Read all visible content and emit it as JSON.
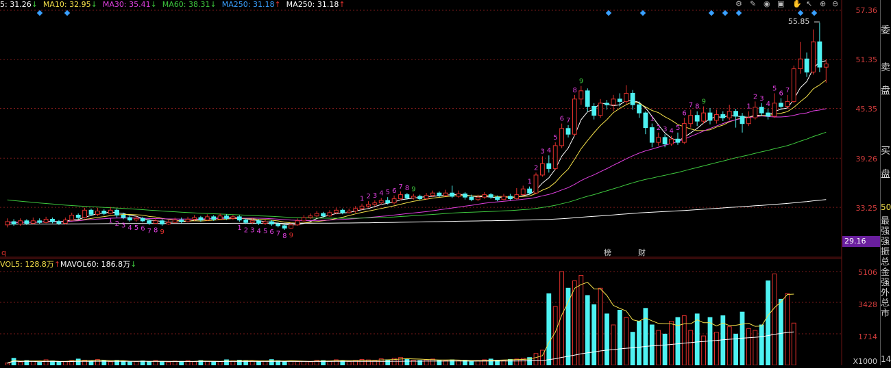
{
  "legend_main": [
    {
      "text": "5: 31.26",
      "arrow": "↓",
      "color": "#ffffff"
    },
    {
      "text": "MA10: 32.95",
      "arrow": "↓",
      "color": "#f4e04a"
    },
    {
      "text": "MA30: 35.41",
      "arrow": "↓",
      "color": "#e040e0"
    },
    {
      "text": "MA60: 38.31",
      "arrow": "↓",
      "color": "#3ec83e"
    },
    {
      "text": "MA250: 31.18",
      "arrow": "↑",
      "color": "#3aa0ff"
    },
    {
      "text": "MA250: 31.18",
      "arrow": "↑",
      "color": "#ffffff"
    }
  ],
  "legend_vol": [
    {
      "text": "VOL5: 128.8万",
      "arrow": "↑",
      "color": "#f4e04a"
    },
    {
      "text": "MAVOL60: 186.8万",
      "arrow": "↓",
      "color": "#ffffff"
    }
  ],
  "price_axis": [
    "57.36",
    "51.35",
    "45.35",
    "39.26",
    "33.25"
  ],
  "current_price_tag": "29.16",
  "vol_axis": [
    "5106",
    "3428",
    "1714"
  ],
  "vol_axis_unit": "X1000",
  "high_label": "55.85",
  "markers": {
    "bang": "榜",
    "cai": "财",
    "q": "q"
  },
  "right_panel": {
    "wei": "委",
    "mai_pan": "卖",
    "pan1": "盘",
    "mai2": "买",
    "pan2": "盘",
    "fifty": "50",
    "vertical": "最强强振总金强外总市",
    "bottom": "14"
  },
  "toolbar_icons": [
    "gear-icon",
    "pen-icon",
    "eye-icon",
    "lock-icon",
    "hand-icon",
    "plus-icon",
    "minus-icon"
  ],
  "colors": {
    "up": "#e0302c",
    "down": "#4ef2f2",
    "ma5": "#ffffff",
    "ma10": "#f4e04a",
    "ma30": "#e040e0",
    "ma60": "#3ec83e",
    "ma250": "#ffffff",
    "grid": "#7a1a1a",
    "tag": "#6a1f9e"
  },
  "chart_data": {
    "type": "candlestick",
    "price_ylim": [
      29.16,
      57.36
    ],
    "vol_ylim": [
      0,
      5106
    ],
    "candles": [
      [
        31.1,
        31.5,
        30.8,
        31.9
      ],
      [
        31.5,
        31.2,
        31.0,
        31.8
      ],
      [
        31.2,
        31.6,
        31.0,
        31.9
      ],
      [
        31.6,
        31.3,
        31.1,
        31.8
      ],
      [
        31.3,
        31.6,
        31.2,
        32.0
      ],
      [
        31.6,
        31.4,
        31.2,
        31.9
      ],
      [
        31.4,
        31.8,
        31.3,
        32.1
      ],
      [
        31.8,
        31.5,
        31.3,
        32.0
      ],
      [
        31.5,
        31.3,
        31.1,
        31.7
      ],
      [
        31.3,
        31.7,
        31.2,
        32.0
      ],
      [
        31.7,
        32.3,
        31.6,
        32.6
      ],
      [
        32.3,
        32.0,
        31.8,
        32.5
      ],
      [
        32.0,
        32.9,
        31.9,
        33.2
      ],
      [
        32.9,
        32.4,
        32.2,
        33.1
      ],
      [
        32.4,
        32.8,
        32.2,
        33.2
      ],
      [
        32.8,
        32.5,
        32.3,
        33.0
      ],
      [
        32.5,
        32.9,
        32.4,
        33.3
      ],
      [
        32.9,
        32.3,
        32.0,
        33.1
      ],
      [
        32.3,
        32.0,
        31.8,
        32.6
      ],
      [
        32.0,
        31.7,
        31.5,
        32.2
      ],
      [
        31.7,
        31.9,
        31.5,
        32.2
      ],
      [
        31.9,
        31.6,
        31.4,
        32.1
      ],
      [
        31.6,
        31.3,
        31.1,
        31.8
      ],
      [
        31.3,
        31.6,
        31.2,
        31.9
      ],
      [
        31.6,
        31.2,
        31.0,
        31.8
      ],
      [
        31.2,
        31.4,
        31.1,
        31.7
      ],
      [
        31.4,
        31.7,
        31.3,
        32.0
      ],
      [
        31.7,
        31.5,
        31.3,
        32.0
      ],
      [
        31.5,
        31.8,
        31.4,
        32.1
      ],
      [
        31.8,
        32.0,
        31.6,
        32.3
      ],
      [
        32.0,
        31.7,
        31.5,
        32.2
      ],
      [
        31.7,
        32.1,
        31.6,
        32.4
      ],
      [
        32.1,
        31.8,
        31.6,
        32.3
      ],
      [
        31.8,
        32.2,
        31.7,
        32.5
      ],
      [
        32.2,
        31.9,
        31.7,
        32.4
      ],
      [
        31.9,
        32.1,
        31.7,
        32.3
      ],
      [
        32.1,
        31.7,
        31.5,
        32.3
      ],
      [
        31.7,
        31.4,
        31.2,
        31.9
      ],
      [
        31.4,
        31.6,
        31.2,
        31.9
      ],
      [
        31.6,
        31.3,
        31.1,
        31.8
      ],
      [
        31.3,
        31.5,
        31.1,
        31.7
      ],
      [
        31.5,
        31.2,
        31.0,
        31.7
      ],
      [
        31.2,
        31.0,
        30.8,
        31.4
      ],
      [
        31.0,
        30.7,
        30.5,
        31.2
      ],
      [
        30.7,
        31.1,
        30.6,
        31.4
      ],
      [
        31.1,
        31.6,
        31.0,
        31.9
      ],
      [
        31.6,
        32.0,
        31.5,
        32.3
      ],
      [
        32.0,
        32.2,
        31.8,
        32.5
      ],
      [
        32.2,
        32.5,
        32.0,
        32.8
      ],
      [
        32.5,
        32.2,
        32.0,
        32.7
      ],
      [
        32.2,
        32.6,
        32.1,
        32.9
      ],
      [
        32.6,
        32.9,
        32.4,
        33.2
      ],
      [
        32.9,
        32.6,
        32.4,
        33.1
      ],
      [
        32.6,
        32.8,
        32.5,
        33.1
      ],
      [
        32.8,
        33.1,
        32.6,
        33.4
      ],
      [
        33.1,
        33.4,
        32.9,
        33.7
      ],
      [
        33.4,
        33.6,
        33.2,
        34.0
      ],
      [
        33.6,
        33.8,
        33.4,
        34.1
      ],
      [
        33.8,
        34.1,
        33.6,
        34.4
      ],
      [
        34.1,
        33.8,
        33.6,
        34.5
      ],
      [
        33.8,
        34.3,
        33.6,
        34.7
      ],
      [
        34.3,
        34.8,
        34.1,
        35.2
      ],
      [
        34.8,
        34.4,
        34.2,
        35.0
      ],
      [
        34.4,
        34.6,
        34.2,
        34.9
      ],
      [
        34.6,
        34.3,
        34.1,
        34.8
      ],
      [
        34.3,
        34.7,
        34.2,
        35.0
      ],
      [
        34.7,
        35.0,
        34.5,
        35.3
      ],
      [
        35.0,
        34.7,
        34.5,
        35.2
      ],
      [
        34.7,
        35.0,
        34.6,
        35.4
      ],
      [
        35.0,
        34.6,
        34.4,
        35.9
      ],
      [
        34.6,
        34.9,
        34.4,
        35.3
      ],
      [
        34.9,
        34.5,
        34.2,
        35.1
      ],
      [
        34.5,
        34.2,
        34.0,
        34.8
      ],
      [
        34.2,
        34.5,
        34.0,
        34.8
      ],
      [
        34.5,
        34.8,
        34.3,
        35.1
      ],
      [
        34.8,
        34.5,
        34.3,
        35.0
      ],
      [
        34.5,
        34.2,
        34.0,
        34.7
      ],
      [
        34.2,
        34.6,
        34.1,
        34.9
      ],
      [
        34.6,
        34.3,
        34.1,
        34.9
      ],
      [
        34.3,
        34.8,
        34.2,
        35.6
      ],
      [
        34.8,
        35.5,
        34.7,
        35.9
      ],
      [
        35.5,
        35.0,
        34.8,
        35.8
      ],
      [
        35.0,
        37.2,
        34.9,
        37.5
      ],
      [
        37.2,
        38.6,
        37.0,
        39.5
      ],
      [
        38.6,
        38.0,
        37.5,
        39.6
      ],
      [
        38.0,
        40.8,
        37.8,
        41.2
      ],
      [
        40.8,
        42.9,
        40.5,
        43.5
      ],
      [
        42.9,
        42.2,
        41.8,
        43.3
      ],
      [
        42.2,
        46.5,
        42.0,
        47.0
      ],
      [
        46.5,
        47.5,
        45.8,
        48.1
      ],
      [
        47.5,
        45.6,
        45.0,
        47.8
      ],
      [
        45.6,
        44.5,
        44.0,
        46.0
      ],
      [
        44.5,
        46.0,
        44.2,
        46.5
      ],
      [
        46.0,
        45.8,
        45.2,
        46.4
      ],
      [
        45.8,
        46.5,
        45.0,
        47.0
      ],
      [
        46.5,
        46.2,
        45.6,
        47.2
      ],
      [
        46.2,
        47.2,
        45.8,
        48.2
      ],
      [
        47.2,
        45.8,
        45.2,
        47.6
      ],
      [
        45.8,
        44.8,
        44.2,
        46.2
      ],
      [
        44.8,
        43.0,
        42.2,
        45.0
      ],
      [
        43.0,
        41.2,
        40.6,
        43.5
      ],
      [
        41.2,
        41.8,
        40.8,
        42.4
      ],
      [
        41.8,
        41.0,
        40.6,
        42.2
      ],
      [
        41.0,
        41.6,
        40.8,
        42.0
      ],
      [
        41.6,
        41.2,
        40.9,
        42.4
      ],
      [
        41.2,
        43.5,
        41.0,
        44.2
      ],
      [
        43.5,
        44.5,
        43.0,
        45.2
      ],
      [
        44.5,
        43.8,
        43.2,
        45.0
      ],
      [
        43.8,
        44.8,
        43.5,
        45.6
      ],
      [
        44.8,
        43.9,
        43.4,
        45.4
      ],
      [
        43.9,
        44.6,
        43.5,
        45.2
      ],
      [
        44.6,
        44.2,
        43.8,
        45.0
      ],
      [
        44.2,
        45.0,
        43.9,
        45.8
      ],
      [
        45.0,
        44.4,
        43.0,
        45.3
      ],
      [
        44.4,
        43.5,
        42.4,
        44.8
      ],
      [
        43.5,
        44.2,
        43.2,
        45.0
      ],
      [
        44.2,
        45.5,
        44.0,
        46.2
      ],
      [
        45.5,
        44.8,
        44.4,
        46.0
      ],
      [
        44.8,
        44.4,
        44.0,
        45.3
      ],
      [
        44.4,
        46.0,
        44.2,
        47.2
      ],
      [
        46.0,
        45.6,
        45.2,
        46.6
      ],
      [
        45.6,
        46.2,
        45.3,
        47.0
      ],
      [
        46.2,
        50.2,
        46.0,
        50.6
      ],
      [
        50.2,
        51.4,
        49.6,
        53.5
      ],
      [
        51.4,
        49.8,
        49.2,
        52.2
      ],
      [
        49.8,
        53.5,
        49.5,
        55.0
      ],
      [
        53.5,
        50.4,
        49.8,
        55.85
      ],
      [
        50.4,
        50.8,
        48.5,
        51.4
      ]
    ],
    "volumes": [
      120,
      380,
      180,
      260,
      220,
      160,
      300,
      240,
      180,
      200,
      260,
      340,
      280,
      220,
      310,
      250,
      190,
      270,
      230,
      180,
      210,
      240,
      200,
      260,
      190,
      170,
      230,
      210,
      250,
      200,
      260,
      220,
      180,
      200,
      300,
      240,
      280,
      260,
      220,
      190,
      230,
      310,
      250,
      200,
      240,
      200,
      220,
      190,
      280,
      260,
      230,
      300,
      250,
      210,
      270,
      320,
      290,
      240,
      350,
      300,
      380,
      420,
      330,
      280,
      260,
      300,
      340,
      280,
      260,
      300,
      240,
      280,
      200,
      260,
      300,
      340,
      280,
      260,
      320,
      340,
      380,
      420,
      640,
      820,
      3900,
      3200,
      5106,
      4200,
      4600,
      4900,
      3800,
      3300,
      4200,
      2800,
      2200,
      3000,
      2600,
      1800,
      2400,
      3100,
      2200,
      1900,
      1700,
      2400,
      2600,
      2700,
      1900,
      2800,
      1600,
      2600,
      1800,
      2700,
      2100,
      1700,
      2900,
      2000,
      1900,
      2200,
      4600,
      4980,
      3600,
      3900,
      2300
    ]
  }
}
